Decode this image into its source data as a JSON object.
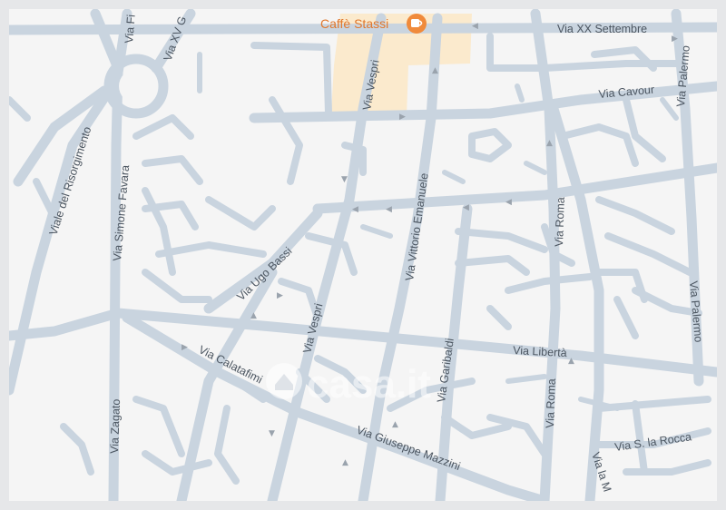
{
  "poi": {
    "name": "Caffè Stassi",
    "icon": "coffee-cup-icon",
    "color": "#f08a3b"
  },
  "streets": {
    "via_xx_settembre": "Via XX Settembre",
    "via_cavour": "Via Cavour",
    "via_palermo_top": "Via Palermo",
    "via_palermo_bottom": "Via Palermo",
    "via_vespri_top": "Via Vespri",
    "via_vespri_bottom": "Via Vespri",
    "via_vittorio_emanuele": "Via Vittorio Emanuele",
    "via_roma_top": "Via Roma",
    "via_roma_bottom": "Via Roma",
    "via_ugo_bassi": "Via Ugo Bassi",
    "via_garibaldi": "Via Garibaldi",
    "via_liberta": "Via Libertà",
    "via_calatafimi": "Via Calatafimi",
    "via_giuseppe_mazzini": "Via Giuseppe Mazzini",
    "via_s_la_rocca": "Via S. la Rocca",
    "via_la_m": "Via la M",
    "viale_del_risorgimento": "Viale del Risorgimento",
    "via_simone_favara": "Via Simone Favara",
    "via_zagato": "Via Zagato",
    "via_fi": "Via Fi",
    "via_xv_g": "Via XV G"
  },
  "watermark": {
    "text": "casa.it",
    "icon": "casa-logo-icon"
  },
  "colors": {
    "road": "#c9d4df",
    "background": "#f5f5f5",
    "highlight_area": "#fbe7c6",
    "label": "#4b5560"
  }
}
